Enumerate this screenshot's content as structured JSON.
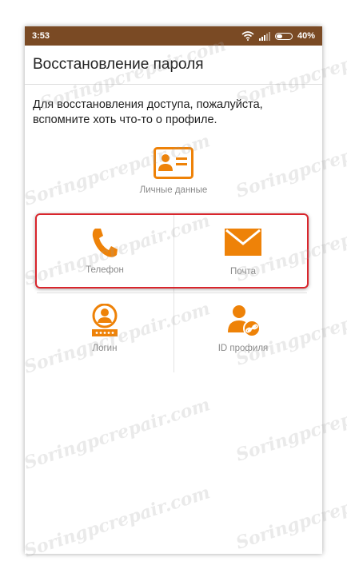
{
  "status_bar": {
    "time": "3:53",
    "battery_percent": "40%",
    "battery_level": 0.4
  },
  "app_bar": {
    "title": "Восстановление пароля"
  },
  "description": "Для восстановления доступа, пожалуйста, вспомните хоть что-то о профиле.",
  "options": {
    "personal_data": "Личные данные",
    "phone": "Телефон",
    "email": "Почта",
    "login": "Логин",
    "profile_id": "ID профиля"
  },
  "icons": {
    "personal_data": "id-card-icon",
    "phone": "phone-icon",
    "email": "envelope-icon",
    "login": "user-password-icon",
    "profile_id": "user-link-icon"
  },
  "watermark": "Soringpcrepair.com",
  "colors": {
    "accent": "#ee8208",
    "status_bar": "#7a4a24",
    "highlight_border": "#d9252c"
  }
}
